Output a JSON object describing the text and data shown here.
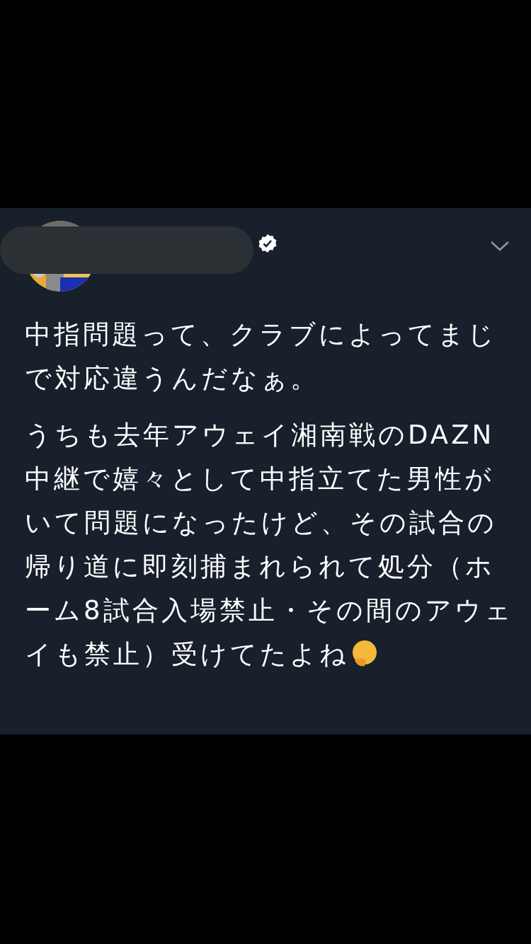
{
  "tweet": {
    "verified": true,
    "paragraphs": [
      "中指問題って、クラブによってまじで対応違うんだなぁ。",
      "うちも去年アウェイ湘南戦のDAZN中継で嬉々として中指立てた男性がいて問題になったけど、その試合の帰り道に即刻捕まれられて処分（ホーム8試合入場禁止・その間のアウェイも禁止）受けてたよね"
    ]
  }
}
